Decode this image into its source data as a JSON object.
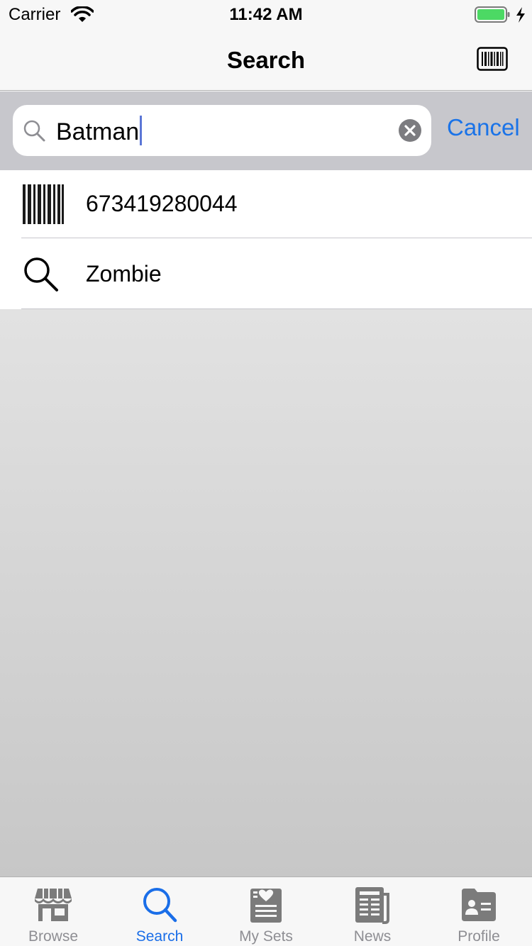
{
  "status_bar": {
    "carrier": "Carrier",
    "time": "11:42 AM",
    "battery_color": "#4cd964"
  },
  "nav": {
    "title": "Search",
    "right_icon": "barcode-icon"
  },
  "search": {
    "value": "Batman",
    "cancel_label": "Cancel",
    "accent_color": "#1a73e8"
  },
  "results": [
    {
      "icon": "barcode-icon",
      "label": "673419280044"
    },
    {
      "icon": "search-icon",
      "label": "Zombie"
    }
  ],
  "tabs": [
    {
      "label": "Browse",
      "icon": "storefront-icon",
      "active": false
    },
    {
      "label": "Search",
      "icon": "search-icon",
      "active": true
    },
    {
      "label": "My Sets",
      "icon": "heart-list-icon",
      "active": false
    },
    {
      "label": "News",
      "icon": "newspaper-icon",
      "active": false
    },
    {
      "label": "Profile",
      "icon": "profile-card-icon",
      "active": false
    }
  ]
}
